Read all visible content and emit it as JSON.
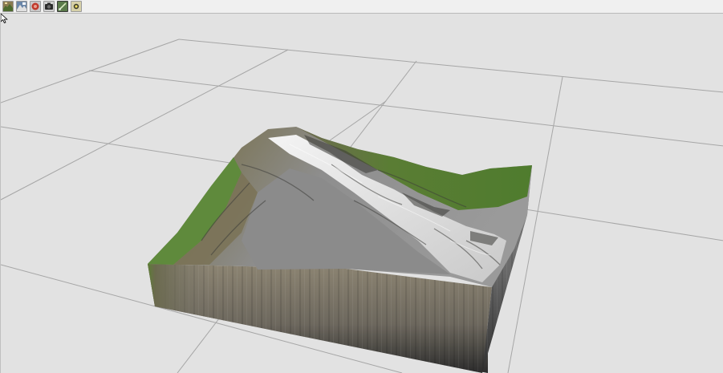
{
  "toolbar": {
    "buttons": [
      {
        "icon": "terrain-view-icon",
        "active": false
      },
      {
        "icon": "heightmap-icon",
        "active": false
      },
      {
        "icon": "record-icon",
        "active": false
      },
      {
        "icon": "camera-icon",
        "active": false
      },
      {
        "icon": "brush-icon",
        "active": true
      },
      {
        "icon": "light-icon",
        "active": false
      }
    ]
  },
  "viewport": {
    "background_color": "#e2e2e2",
    "grid_color": "#a6a6a6",
    "terrain_colors": {
      "grass": "#5f8a3c",
      "rock_brown": "#7a6e5c",
      "rock_gray": "#8e8e8e",
      "snow": "#f2f2f2",
      "cliff_shadow": "#3a3a3a"
    }
  },
  "cursor": {
    "icon": "arrow-cursor-icon"
  }
}
